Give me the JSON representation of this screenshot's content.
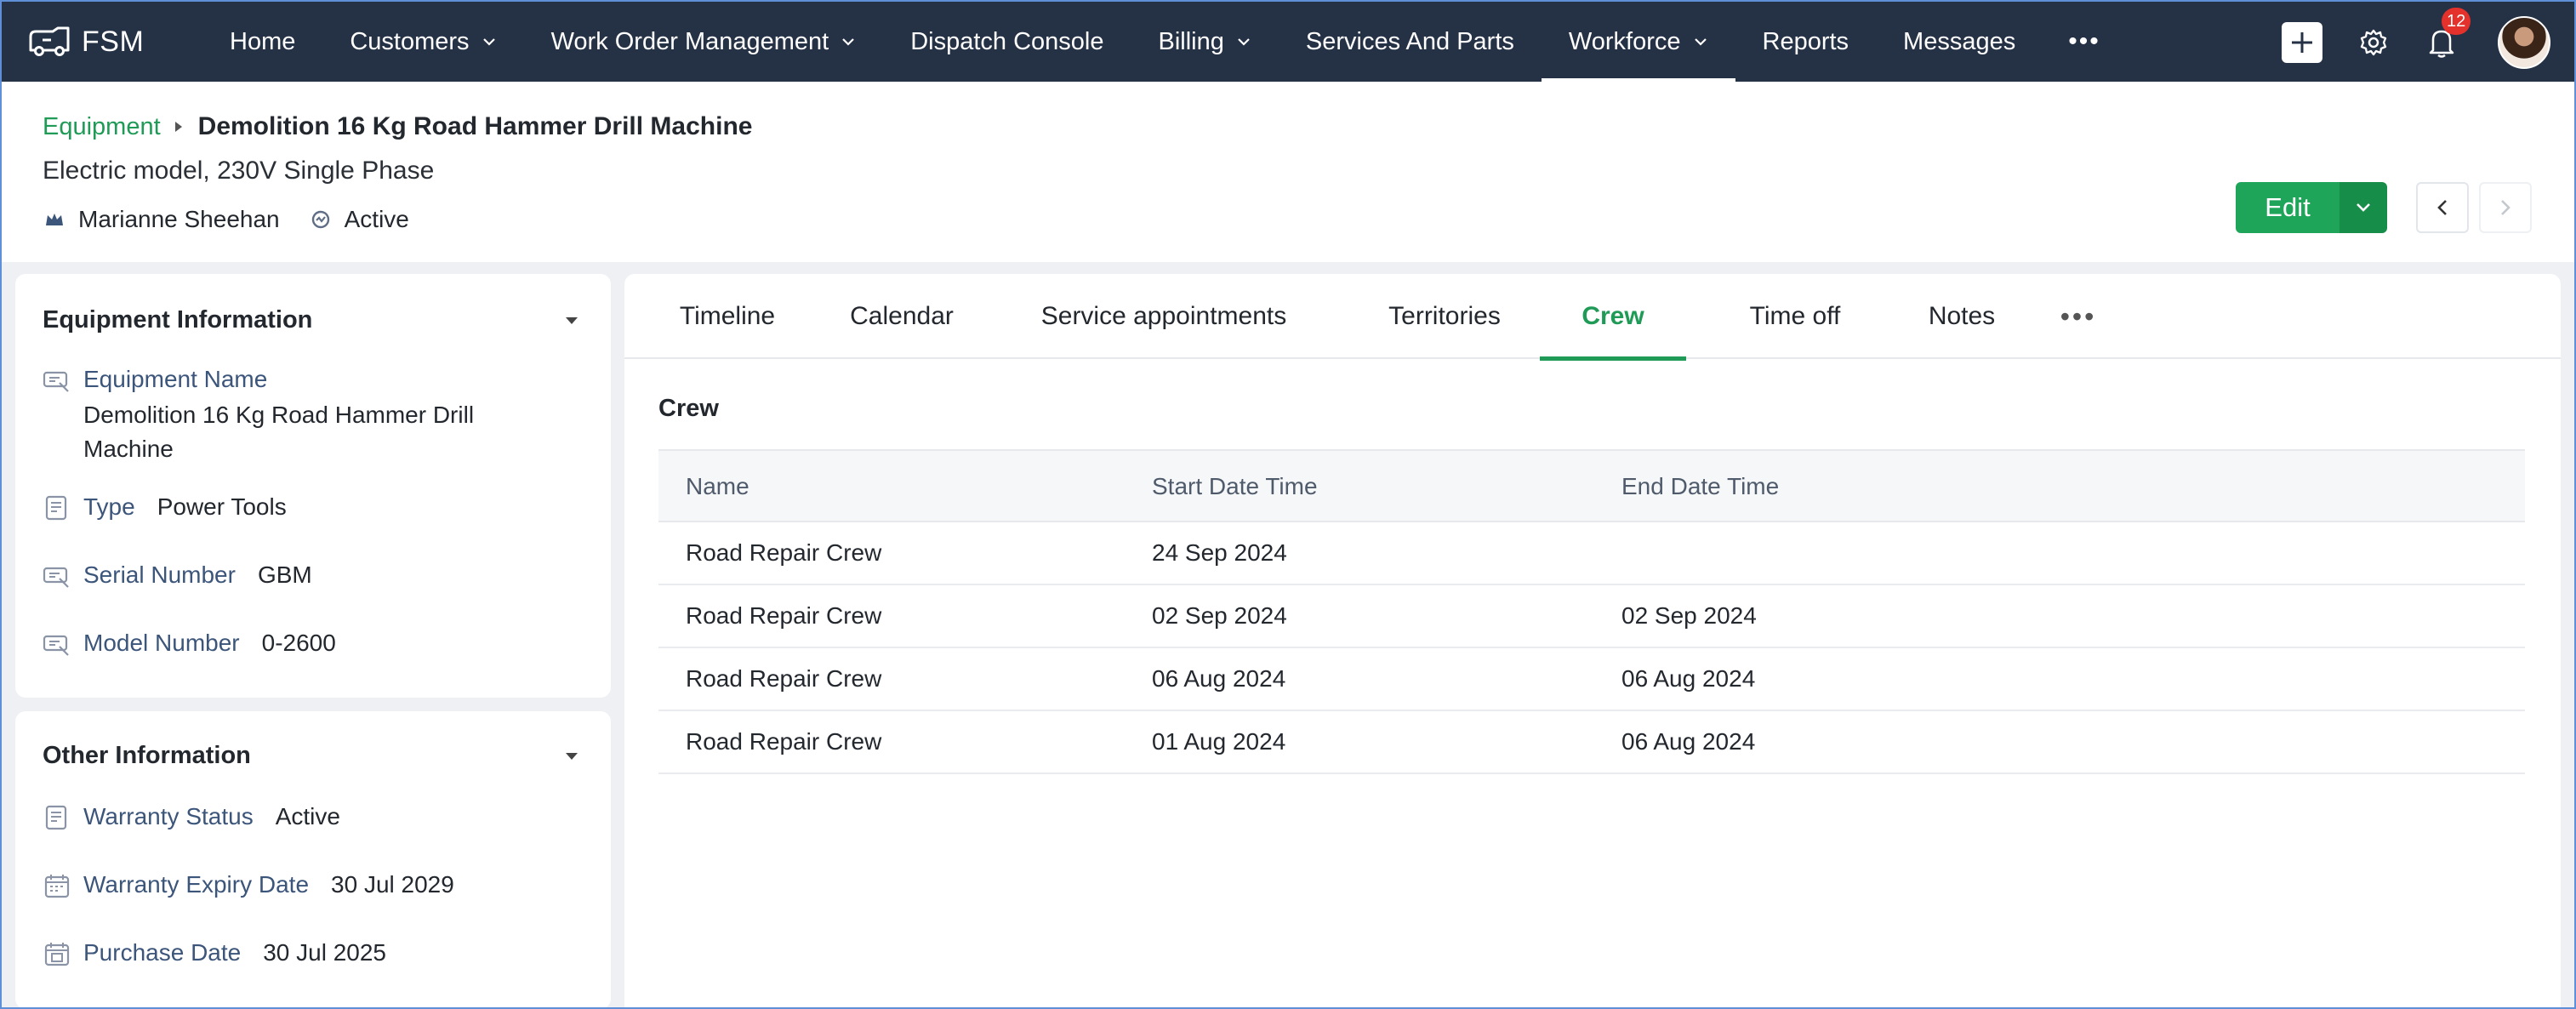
{
  "app": {
    "brand": "FSM"
  },
  "nav": {
    "items": [
      {
        "label": "Home",
        "dropdown": false,
        "active": false
      },
      {
        "label": "Customers",
        "dropdown": true,
        "active": false
      },
      {
        "label": "Work Order Management",
        "dropdown": true,
        "active": false
      },
      {
        "label": "Dispatch Console",
        "dropdown": false,
        "active": false
      },
      {
        "label": "Billing",
        "dropdown": true,
        "active": false
      },
      {
        "label": "Services And Parts",
        "dropdown": false,
        "active": false
      },
      {
        "label": "Workforce",
        "dropdown": true,
        "active": true
      },
      {
        "label": "Reports",
        "dropdown": false,
        "active": false
      },
      {
        "label": "Messages",
        "dropdown": false,
        "active": false
      }
    ],
    "more_label": "•••",
    "notification_count": "12"
  },
  "header": {
    "breadcrumb_link": "Equipment",
    "title": "Demolition 16 Kg Road Hammer Drill Machine",
    "subtitle": "Electric model, 230V Single Phase",
    "owner": "Marianne Sheehan",
    "status": "Active",
    "edit_label": "Edit"
  },
  "equipment_info": {
    "title": "Equipment Information",
    "fields": [
      {
        "label": "Equipment Name",
        "value": "Demolition 16 Kg Road Hammer Drill Machine",
        "icon": "tag-icon"
      },
      {
        "label": "Type",
        "value": "Power Tools",
        "icon": "document-icon"
      },
      {
        "label": "Serial Number",
        "value": "GBM",
        "icon": "tag-icon"
      },
      {
        "label": "Model Number",
        "value": "0-2600",
        "icon": "tag-icon"
      }
    ]
  },
  "other_info": {
    "title": "Other Information",
    "fields": [
      {
        "label": "Warranty Status",
        "value": "Active",
        "icon": "document-icon"
      },
      {
        "label": "Warranty Expiry Date",
        "value": "30 Jul 2029",
        "icon": "calendar-icon"
      },
      {
        "label": "Purchase Date",
        "value": "30 Jul 2025",
        "icon": "calendar-icon"
      }
    ]
  },
  "tabs": {
    "items": [
      "Timeline",
      "Calendar",
      "Service appointments",
      "Territories",
      "Crew",
      "Time off",
      "Notes"
    ],
    "active": "Crew",
    "more_label": "•••"
  },
  "crew": {
    "section_title": "Crew",
    "columns": [
      "Name",
      "Start Date Time",
      "End Date Time"
    ],
    "rows": [
      {
        "name": "Road Repair Crew",
        "start": "24 Sep 2024",
        "end": ""
      },
      {
        "name": "Road Repair Crew",
        "start": "02 Sep 2024",
        "end": "02 Sep 2024"
      },
      {
        "name": "Road Repair Crew",
        "start": "06 Aug 2024",
        "end": "06 Aug 2024"
      },
      {
        "name": "Road Repair Crew",
        "start": "01 Aug 2024",
        "end": "06 Aug 2024"
      }
    ]
  },
  "colors": {
    "nav_bg": "#253246",
    "accent_green": "#1ea559",
    "link_green": "#1f9a57",
    "badge_red": "#e4312b"
  }
}
